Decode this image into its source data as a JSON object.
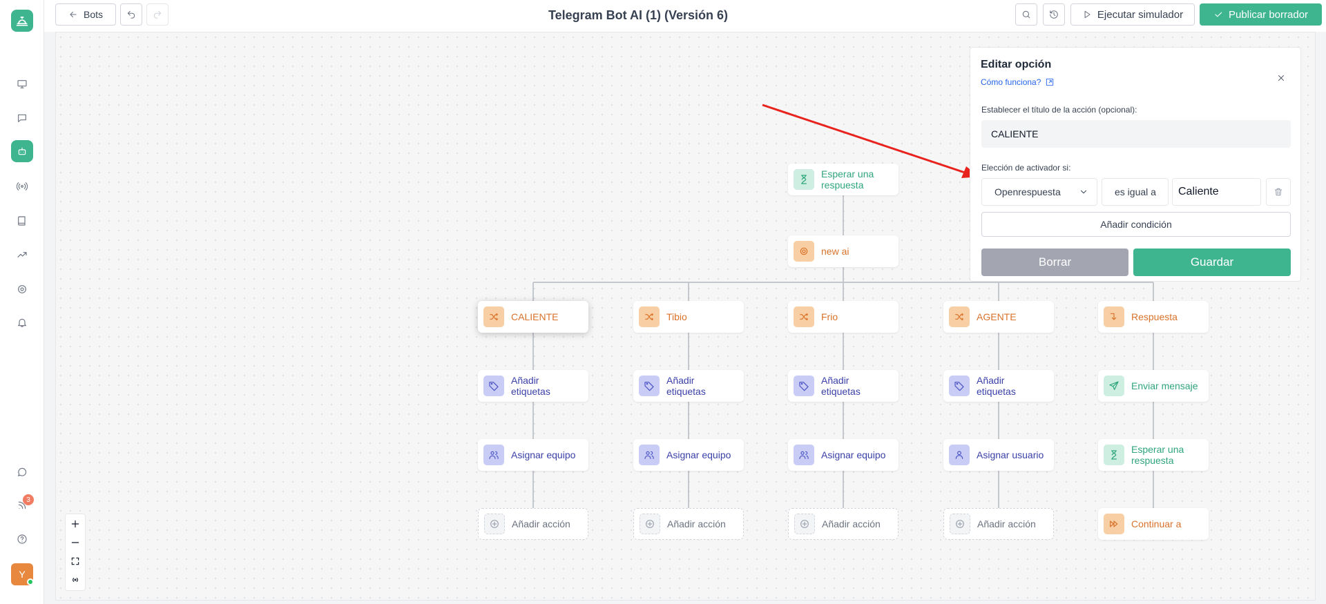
{
  "header": {
    "back_label": "Bots",
    "title": "Telegram Bot AI (1) (Versión 6)",
    "simulator_label": "Ejecutar simulador",
    "publish_label": "Publicar borrador"
  },
  "sidebar": {
    "notification_count": "3",
    "avatar_initial": "Y",
    "brand_color": "#3fb58f"
  },
  "flow": {
    "wait_node": "Esperar una respuesta",
    "ai_node": "new ai",
    "branches": [
      {
        "option": "CALIENTE",
        "step1": "Añadir etiquetas",
        "step2": "Asignar equipo",
        "step3": "Añadir acción"
      },
      {
        "option": "Tibio",
        "step1": "Añadir etiquetas",
        "step2": "Asignar equipo",
        "step3": "Añadir acción"
      },
      {
        "option": "Frio",
        "step1": "Añadir etiquetas",
        "step2": "Asignar equipo",
        "step3": "Añadir acción"
      },
      {
        "option": "AGENTE",
        "step1": "Añadir etiquetas",
        "step2": "Asignar usuario",
        "step3": "Añadir acción"
      },
      {
        "option": "Respuesta",
        "step1": "Enviar mensaje",
        "step2": "Esperar una respuesta",
        "step3": "Continuar a"
      }
    ]
  },
  "panel": {
    "title": "Editar opción",
    "help_link": "Cómo funciona?",
    "action_title_label": "Establecer el título de la acción (opcional):",
    "action_title_value": "CALIENTE",
    "trigger_label": "Elección de activador si:",
    "condition_field": "Openrespuesta",
    "condition_operator": "es igual a",
    "condition_value": "Caliente",
    "add_condition_label": "Añadir condición",
    "delete_label": "Borrar",
    "save_label": "Guardar"
  }
}
